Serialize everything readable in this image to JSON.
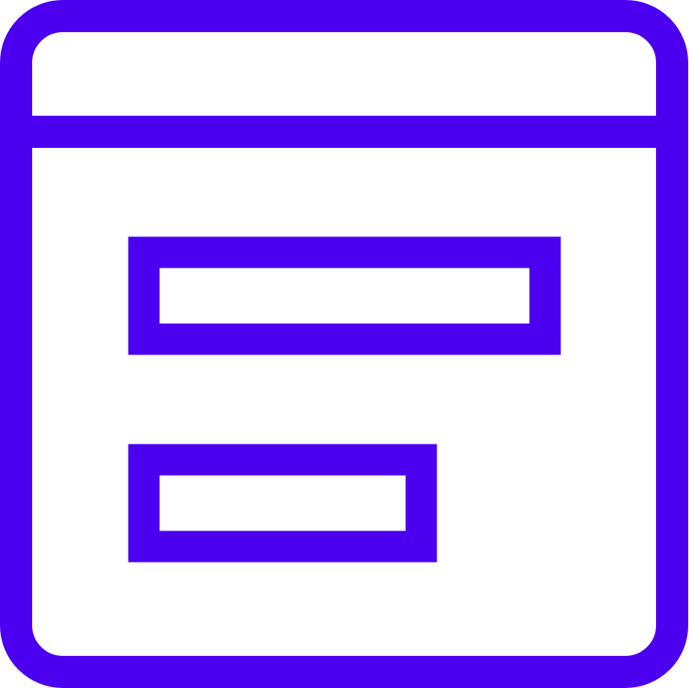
{
  "icon": {
    "name": "browser-window-form-icon",
    "stroke_color": "#4B00F0",
    "background_color": "#FFFFFF"
  }
}
